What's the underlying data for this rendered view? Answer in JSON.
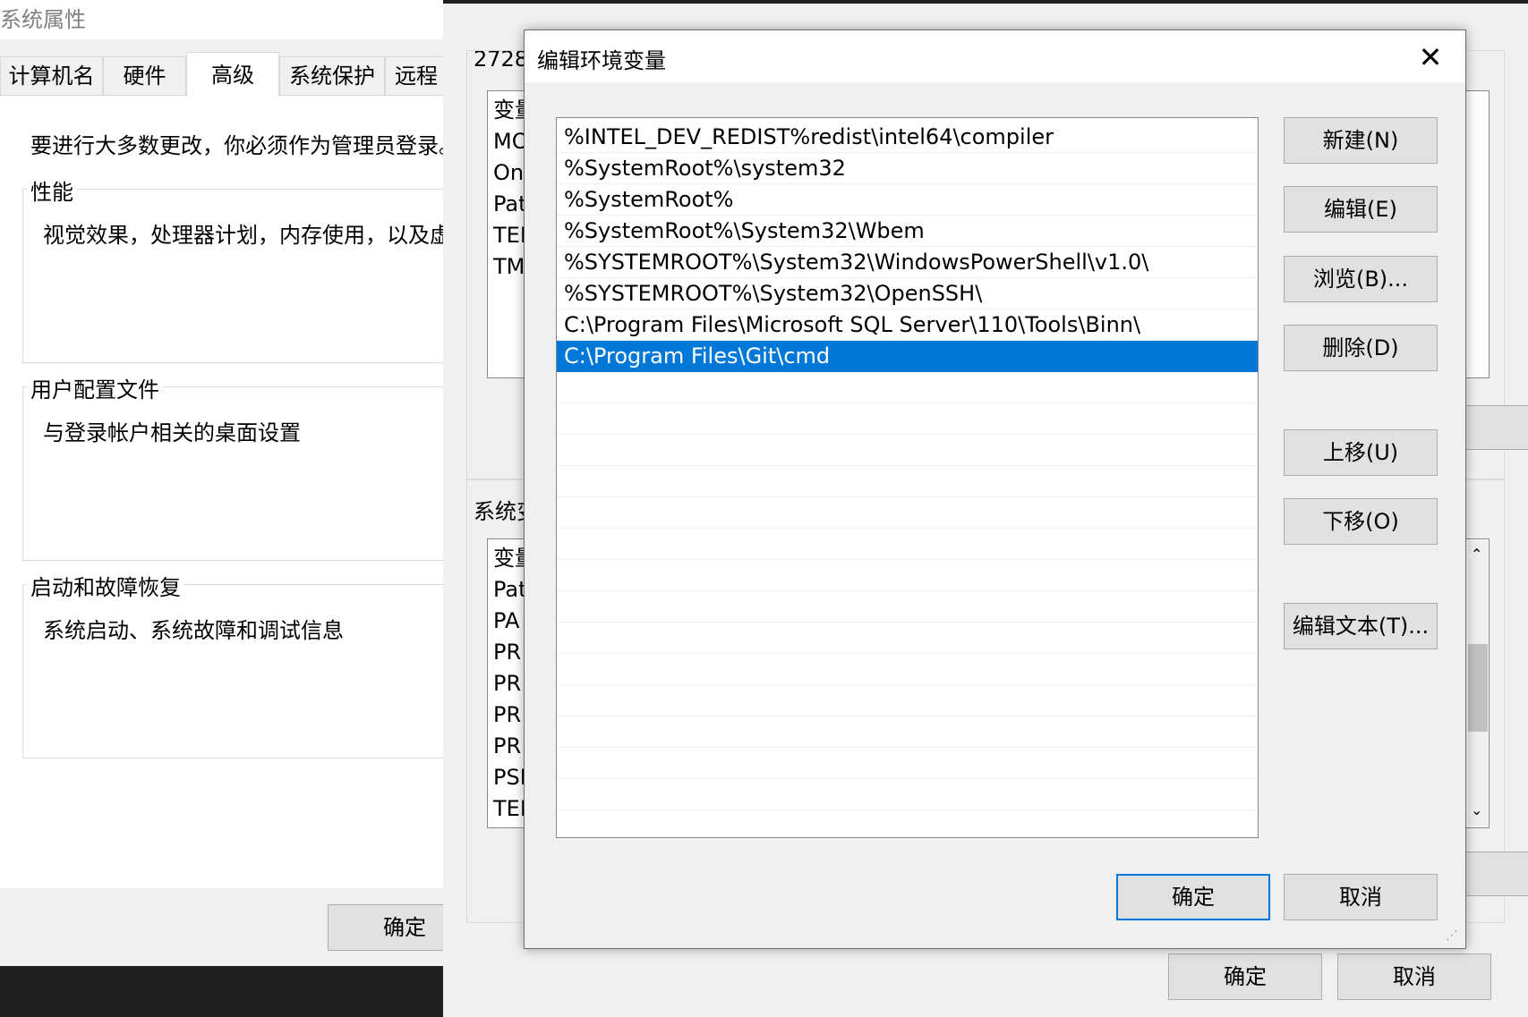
{
  "system_properties": {
    "title": "系统属性",
    "tabs": [
      "计算机名",
      "硬件",
      "高级",
      "系统保护",
      "远程"
    ],
    "active_tab": "高级",
    "admin_notice": "要进行大多数更改，你必须作为管理员登录。",
    "groups": [
      {
        "title": "性能",
        "description": "视觉效果，处理器计划，内存使用，以及虚"
      },
      {
        "title": "用户配置文件",
        "description": "与登录帐户相关的桌面设置"
      },
      {
        "title": "启动和故障恢复",
        "description": "系统启动、系统故障和调试信息"
      }
    ],
    "ok_label": "确定"
  },
  "environment_variables": {
    "user_section_label": "2728",
    "user_vars_header": "变量",
    "user_vars": [
      "MO",
      "On",
      "Pat",
      "TEI",
      "TM"
    ],
    "system_section_label": "系统变",
    "system_vars_header": "变量",
    "system_vars": [
      "Pat",
      "PA",
      "PR",
      "PR",
      "PR",
      "PR",
      "PSI",
      "TEN"
    ],
    "ok_label": "确定",
    "cancel_label": "取消"
  },
  "edit_dialog": {
    "title": "编辑环境变量",
    "close_symbol": "✕",
    "paths": [
      "%INTEL_DEV_REDIST%redist\\intel64\\compiler",
      "%SystemRoot%\\system32",
      "%SystemRoot%",
      "%SystemRoot%\\System32\\Wbem",
      "%SYSTEMROOT%\\System32\\WindowsPowerShell\\v1.0\\",
      "%SYSTEMROOT%\\System32\\OpenSSH\\",
      "C:\\Program Files\\Microsoft SQL Server\\110\\Tools\\Binn\\",
      "C:\\Program Files\\Git\\cmd"
    ],
    "selected_index": 7,
    "buttons": {
      "new": "新建(N)",
      "edit": "编辑(E)",
      "browse": "浏览(B)...",
      "delete": "删除(D)",
      "move_up": "上移(U)",
      "move_down": "下移(O)",
      "edit_text": "编辑文本(T)...",
      "ok": "确定",
      "cancel": "取消"
    },
    "accent_color": "#0078d7"
  }
}
